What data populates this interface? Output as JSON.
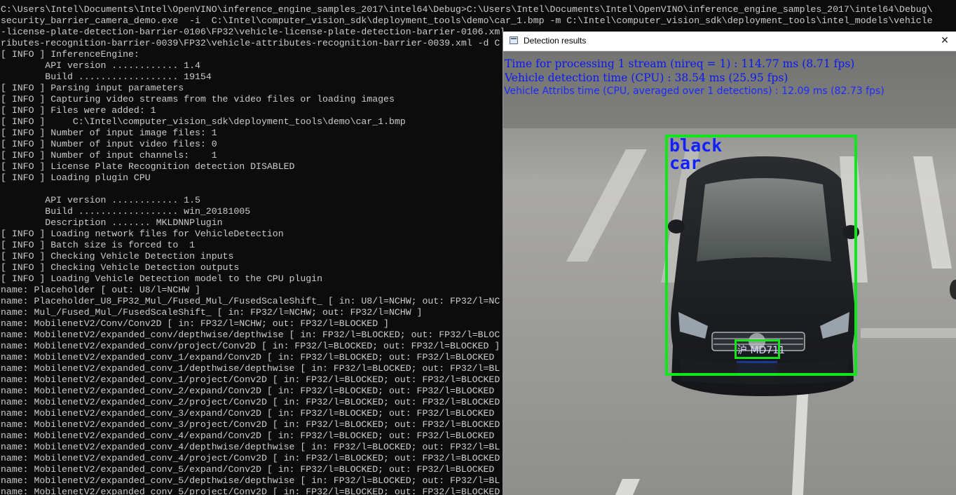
{
  "console": {
    "lines": [
      "C:\\Users\\Intel\\Documents\\Intel\\OpenVINO\\inference_engine_samples_2017\\intel64\\Debug>C:\\Users\\Intel\\Documents\\Intel\\OpenVINO\\inference_engine_samples_2017\\intel64\\Debug\\",
      "security_barrier_camera_demo.exe  -i  C:\\Intel\\computer_vision_sdk\\deployment_tools\\demo\\car_1.bmp -m C:\\Intel\\computer_vision_sdk\\deployment_tools\\intel_models\\vehicle",
      "-license-plate-detection-barrier-0106\\FP32\\vehicle-license-plate-detection-barrier-0106.xml",
      "ributes-recognition-barrier-0039\\FP32\\vehicle-attributes-recognition-barrier-0039.xml -d C",
      "[ INFO ] InferenceEngine:",
      "        API version ............ 1.4",
      "        Build .................. 19154",
      "[ INFO ] Parsing input parameters",
      "[ INFO ] Capturing video streams from the video files or loading images",
      "[ INFO ] Files were added: 1",
      "[ INFO ]     C:\\Intel\\computer_vision_sdk\\deployment_tools\\demo\\car_1.bmp",
      "[ INFO ] Number of input image files: 1",
      "[ INFO ] Number of input video files: 0",
      "[ INFO ] Number of input channels:    1",
      "[ INFO ] License Plate Recognition detection DISABLED",
      "[ INFO ] Loading plugin CPU",
      "",
      "        API version ............ 1.5",
      "        Build .................. win_20181005",
      "        Description ....... MKLDNNPlugin",
      "[ INFO ] Loading network files for VehicleDetection",
      "[ INFO ] Batch size is forced to  1",
      "[ INFO ] Checking Vehicle Detection inputs",
      "[ INFO ] Checking Vehicle Detection outputs",
      "[ INFO ] Loading Vehicle Detection model to the CPU plugin",
      "name: Placeholder [ out: U8/l=NCHW ]",
      "name: Placeholder_U8_FP32_Mul_/Fused_Mul_/FusedScaleShift_ [ in: U8/l=NCHW; out: FP32/l=NC",
      "name: Mul_/Fused_Mul_/FusedScaleShift_ [ in: FP32/l=NCHW; out: FP32/l=NCHW ]",
      "name: MobilenetV2/Conv/Conv2D [ in: FP32/l=NCHW; out: FP32/l=BLOCKED ]",
      "name: MobilenetV2/expanded_conv/depthwise/depthwise [ in: FP32/l=BLOCKED; out: FP32/l=BLOC",
      "name: MobilenetV2/expanded_conv/project/Conv2D [ in: FP32/l=BLOCKED; out: FP32/l=BLOCKED ]",
      "name: MobilenetV2/expanded_conv_1/expand/Conv2D [ in: FP32/l=BLOCKED; out: FP32/l=BLOCKED",
      "name: MobilenetV2/expanded_conv_1/depthwise/depthwise [ in: FP32/l=BLOCKED; out: FP32/l=BL",
      "name: MobilenetV2/expanded_conv_1/project/Conv2D [ in: FP32/l=BLOCKED; out: FP32/l=BLOCKED",
      "name: MobilenetV2/expanded_conv_2/expand/Conv2D [ in: FP32/l=BLOCKED; out: FP32/l=BLOCKED",
      "name: MobilenetV2/expanded_conv_2/project/Conv2D [ in: FP32/l=BLOCKED; out: FP32/l=BLOCKED",
      "name: MobilenetV2/expanded_conv_3/expand/Conv2D [ in: FP32/l=BLOCKED; out: FP32/l=BLOCKED",
      "name: MobilenetV2/expanded_conv_3/project/Conv2D [ in: FP32/l=BLOCKED; out: FP32/l=BLOCKED",
      "name: MobilenetV2/expanded_conv_4/expand/Conv2D [ in: FP32/l=BLOCKED; out: FP32/l=BLOCKED",
      "name: MobilenetV2/expanded_conv_4/depthwise/depthwise [ in: FP32/l=BLOCKED; out: FP32/l=BL",
      "name: MobilenetV2/expanded_conv_4/project/Conv2D [ in: FP32/l=BLOCKED; out: FP32/l=BLOCKED",
      "name: MobilenetV2/expanded_conv_5/expand/Conv2D [ in: FP32/l=BLOCKED; out: FP32/l=BLOCKED",
      "name: MobilenetV2/expanded_conv_5/depthwise/depthwise [ in: FP32/l=BLOCKED; out: FP32/l=BL",
      "name: MobilenetV2/expanded_conv_5/project/Conv2D [ in: FP32/l=BLOCKED; out: FP32/l=BLOCKED"
    ]
  },
  "detection_window": {
    "title": "Detection results",
    "close_glyph": "✕",
    "overlay": {
      "time_text": "Time for processing 1 stream (nireq = 1) : 114.77 ms (8.71 fps)",
      "vehicle_detection_text": "Vehicle detection time (CPU) : 38.54 ms (25.95 fps)",
      "vehicle_attribs_text": "Vehicle Attribs time (CPU, averaged over 1 detections) : 12.09 ms (82.73 fps)",
      "car_label": "black\ncar",
      "plate_text": "沪 MD711"
    }
  },
  "colors": {
    "console_bg": "#0c0c0c",
    "console_text": "#cccccc",
    "overlay_text": "#0a19f0",
    "detection_box": "#12e51c"
  }
}
